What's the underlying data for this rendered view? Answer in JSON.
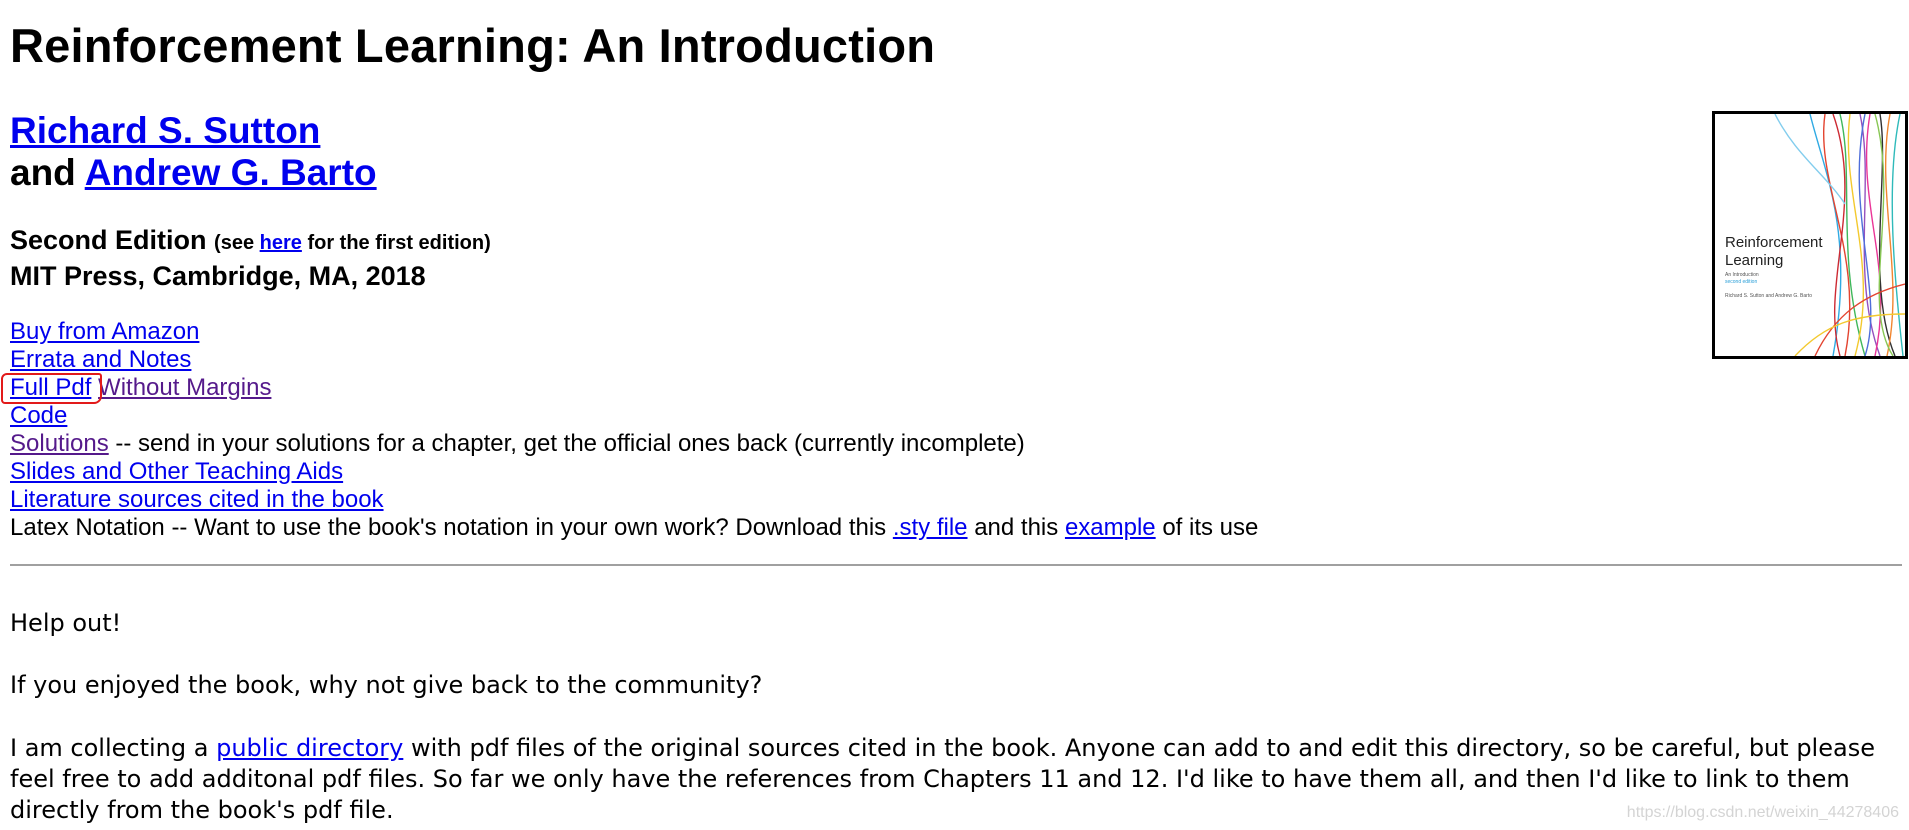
{
  "page": {
    "title": "Reinforcement Learning: An Introduction",
    "authors": {
      "author1": "Richard S. Sutton",
      "conjunction": "and",
      "author2": "Andrew G. Barto"
    },
    "edition": {
      "label": "Second Edition",
      "see_prefix": "(see",
      "here_link": "here",
      "see_suffix": "for the first edition)",
      "publisher": "MIT Press, Cambridge, MA, 2018"
    }
  },
  "links": {
    "buy_amazon": "Buy from Amazon",
    "errata": "Errata and Notes",
    "full_pdf": "Full Pdf",
    "without_margins": "Without Margins",
    "code": "Code",
    "solutions": "Solutions",
    "solutions_text": "-- send in your solutions for a chapter, get the official ones back (currently incomplete)",
    "slides": "Slides and Other Teaching Aids",
    "literature": "Literature sources cited in the book",
    "latex_prefix": "Latex Notation -- Want to use the book's notation in your own work? Download this",
    "sty_file": ".sty file",
    "latex_middle": "and this",
    "example": "example",
    "latex_suffix": "of its use"
  },
  "cover": {
    "title_line1": "Reinforcement",
    "title_line2": "Learning",
    "subtitle": "An Introduction",
    "edition": "second edition",
    "authors": "Richard S. Sutton and Andrew G. Barto"
  },
  "help": {
    "heading": "Help out!",
    "question": "If you enjoyed the book, why not give back to the community?",
    "para_prefix": "I am collecting a",
    "public_directory": "public directory",
    "para_suffix": "with pdf files of the original sources cited in the book. Anyone can add to and edit this directory, so be careful, but please feel free to add additonal pdf files. So far we only have the references from Chapters 11 and 12. I'd like to have them all, and then I'd like to link to them directly from the book's pdf file."
  },
  "watermark": "https://blog.csdn.net/weixin_44278406",
  "colors": {
    "link": "#0000ee",
    "visited_link": "#551a8b",
    "annotation": "#e21a1a",
    "rule": "#a0a0a0"
  }
}
